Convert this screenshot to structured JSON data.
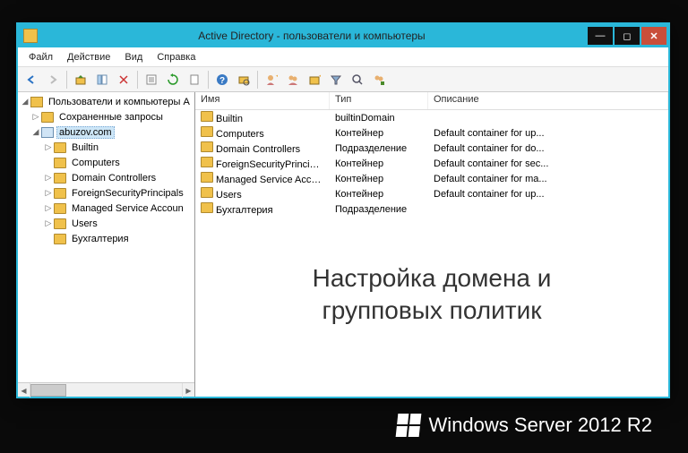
{
  "window": {
    "title": "Active Directory - пользователи и компьютеры"
  },
  "menu": {
    "file": "Файл",
    "action": "Действие",
    "view": "Вид",
    "help": "Справка"
  },
  "tree": {
    "root": "Пользователи и компьютеры A",
    "saved": "Сохраненные запросы",
    "domain": "abuzov.com",
    "n0": "Builtin",
    "n1": "Computers",
    "n2": "Domain Controllers",
    "n3": "ForeignSecurityPrincipals",
    "n4": "Managed Service Accoun",
    "n5": "Users",
    "n6": "Бухгалтерия"
  },
  "columns": {
    "name": "Имя",
    "type": "Тип",
    "desc": "Описание"
  },
  "items": [
    {
      "name": "Builtin",
      "type": "builtinDomain",
      "desc": ""
    },
    {
      "name": "Computers",
      "type": "Контейнер",
      "desc": "Default container for up..."
    },
    {
      "name": "Domain Controllers",
      "type": "Подразделение",
      "desc": "Default container for do..."
    },
    {
      "name": "ForeignSecurityPrincipals",
      "type": "Контейнер",
      "desc": "Default container for sec..."
    },
    {
      "name": "Managed Service Accou...",
      "type": "Контейнер",
      "desc": "Default container for ma..."
    },
    {
      "name": "Users",
      "type": "Контейнер",
      "desc": "Default container for up..."
    },
    {
      "name": "Бухгалтерия",
      "type": "Подразделение",
      "desc": ""
    }
  ],
  "overlay": {
    "line1": "Настройка домена и",
    "line2": "групповых политик"
  },
  "footer": {
    "text": "Windows Server 2012 R2"
  }
}
